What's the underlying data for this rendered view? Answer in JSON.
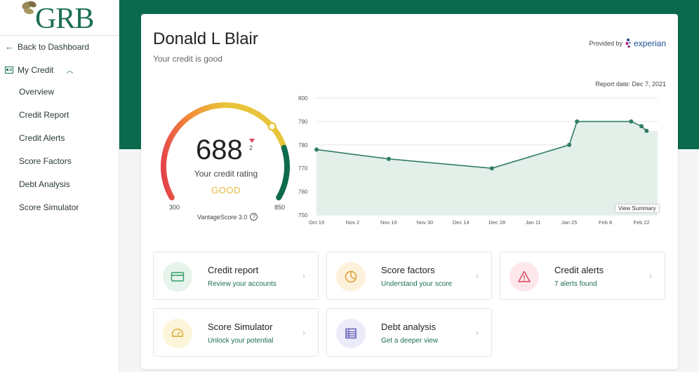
{
  "brand": {
    "logo_text": "GRB",
    "primary_color": "#0b6a4e"
  },
  "sidebar": {
    "back_label": "Back to Dashboard",
    "section_label": "My Credit",
    "items": [
      {
        "label": "Overview"
      },
      {
        "label": "Credit Report"
      },
      {
        "label": "Credit Alerts"
      },
      {
        "label": "Score Factors"
      },
      {
        "label": "Debt Analysis"
      },
      {
        "label": "Score Simulator"
      }
    ]
  },
  "header": {
    "name": "Donald L Blair",
    "subtitle": "Your credit is good",
    "provided_by": "Provided by",
    "provider": "experian",
    "report_date": "Report date: Dec 7, 2021"
  },
  "score": {
    "value": "688",
    "delta": "2",
    "delta_direction": "down",
    "rating_label": "Your credit rating",
    "rating": "GOOD",
    "min": "300",
    "max": "850",
    "model": "VantageScore 3.0",
    "gauge_colors": [
      "#e23d4b",
      "#f28c38",
      "#e8c43a",
      "#0e6b4e"
    ]
  },
  "chart_data": {
    "type": "area",
    "x_labels": [
      "Oct 19",
      "Nov 2",
      "Nov 16",
      "Nov 30",
      "Dec 14",
      "Dec 28",
      "Jan 11",
      "Jan 25",
      "Feb 8",
      "Feb 22"
    ],
    "y_ticks": [
      750,
      760,
      770,
      780,
      790,
      800
    ],
    "ylim": [
      750,
      800
    ],
    "points": [
      {
        "x": "Oct 19",
        "y": 778
      },
      {
        "x": "Nov 16",
        "y": 774
      },
      {
        "x": "Dec 26",
        "y": 770
      },
      {
        "x": "Jan 25",
        "y": 780
      },
      {
        "x": "Jan 28",
        "y": 790
      },
      {
        "x": "Feb 18",
        "y": 790
      },
      {
        "x": "Feb 22",
        "y": 788
      },
      {
        "x": "Feb 24",
        "y": 786
      }
    ],
    "line_color": "#2f7d66",
    "fill_color": "#e3efe9",
    "button_label": "View Summary"
  },
  "tiles": [
    {
      "title": "Credit report",
      "subtitle": "Review your accounts",
      "icon": "card-icon",
      "bg": "#e6f4ec",
      "fg": "#2e9c63"
    },
    {
      "title": "Score factors",
      "subtitle": "Understand your score",
      "icon": "pie-icon",
      "bg": "#fdf1dc",
      "fg": "#d99a2b"
    },
    {
      "title": "Credit alerts",
      "subtitle": "7 alerts found",
      "icon": "warning-icon",
      "bg": "#fde7ea",
      "fg": "#d9465e"
    },
    {
      "title": "Score Simulator",
      "subtitle": "Unlock your potential",
      "icon": "gauge-icon",
      "bg": "#fdf5d9",
      "fg": "#d3a62a"
    },
    {
      "title": "Debt analysis",
      "subtitle": "Get a deeper view",
      "icon": "table-icon",
      "bg": "#ecebf9",
      "fg": "#5b55b5"
    }
  ]
}
